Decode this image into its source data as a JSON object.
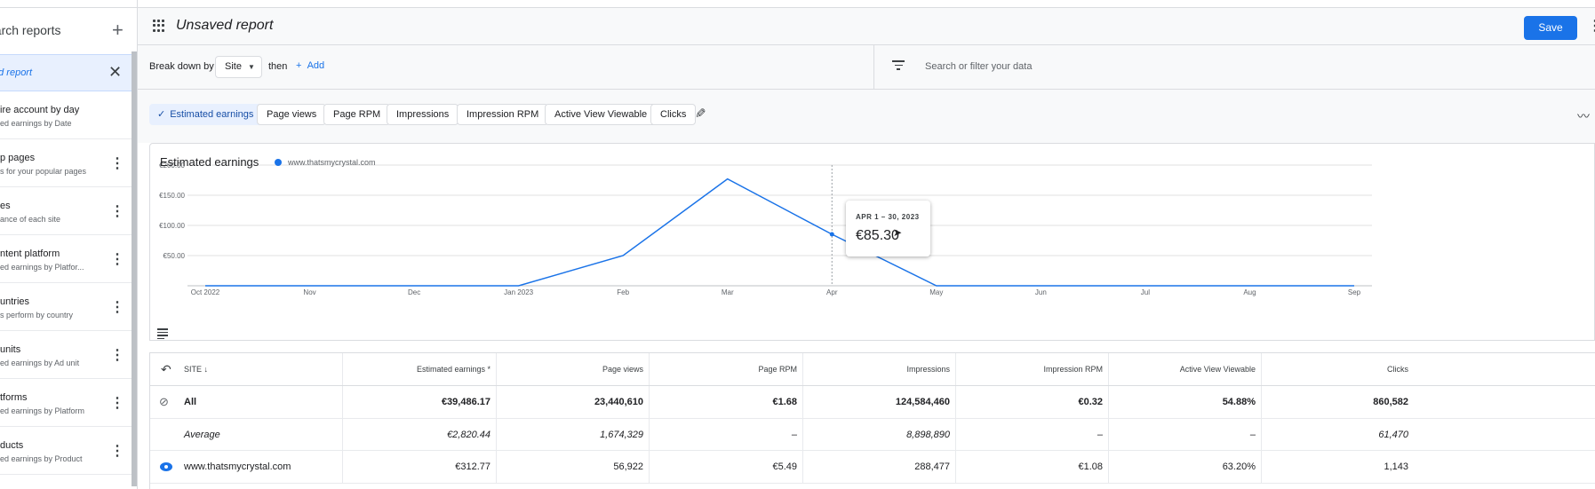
{
  "sidebar": {
    "search_label": "earch reports",
    "active_report": "ed report",
    "items": [
      {
        "title": "ire account by day",
        "subtitle": "ed earnings by Date"
      },
      {
        "title": "p pages",
        "subtitle": "s for your popular pages"
      },
      {
        "title": "es",
        "subtitle": "ance of each site"
      },
      {
        "title": "ntent platform",
        "subtitle": "ed earnings by Platfor..."
      },
      {
        "title": "untries",
        "subtitle": "s perform by country"
      },
      {
        "title": "units",
        "subtitle": "ed earnings by Ad unit"
      },
      {
        "title": "tforms",
        "subtitle": "ed earnings by Platform"
      },
      {
        "title": "ducts",
        "subtitle": "ed earnings by Product"
      }
    ]
  },
  "header": {
    "title": "Unsaved report",
    "save_label": "Save"
  },
  "breakdown": {
    "label": "Break down by",
    "dimension": "Site",
    "then_label": "then",
    "add_label": "Add",
    "search_placeholder": "Search or filter your data"
  },
  "metrics": [
    {
      "label": "Estimated earnings",
      "selected": true
    },
    {
      "label": "Page views",
      "selected": false
    },
    {
      "label": "Page RPM",
      "selected": false
    },
    {
      "label": "Impressions",
      "selected": false
    },
    {
      "label": "Impression RPM",
      "selected": false
    },
    {
      "label": "Active View Viewable",
      "selected": false
    },
    {
      "label": "Clicks",
      "selected": false
    }
  ],
  "chart_data": {
    "type": "line",
    "title": "Estimated earnings",
    "series": [
      {
        "name": "www.thatsmycrystal.com",
        "color": "#1a73e8",
        "values": [
          0,
          0,
          0,
          0,
          50,
          177,
          85.3,
          0,
          0,
          0,
          0,
          0
        ]
      }
    ],
    "x": [
      "Oct 2022",
      "Nov",
      "Dec",
      "Jan 2023",
      "Feb",
      "Mar",
      "Apr",
      "May",
      "Jun",
      "Jul",
      "Aug",
      "Sep"
    ],
    "y_ticks": [
      "€50.00",
      "€100.00",
      "€150.00",
      "€200.00"
    ],
    "ylim": [
      0,
      200
    ],
    "grid": true,
    "tooltip": {
      "date": "APR 1 – 30, 2023",
      "value": "€85.30"
    }
  },
  "table": {
    "columns": [
      "SITE",
      "Estimated earnings *",
      "Page views",
      "Page RPM",
      "Impressions",
      "Impression RPM",
      "Active View Viewable",
      "Clicks"
    ],
    "rows": [
      {
        "label": "All",
        "values": [
          "€39,486.17",
          "23,440,610",
          "€1.68",
          "124,584,460",
          "€0.32",
          "54.88%",
          "860,582"
        ]
      },
      {
        "label": "Average",
        "values": [
          "€2,820.44",
          "1,674,329",
          "–",
          "8,898,890",
          "–",
          "–",
          "61,470"
        ]
      },
      {
        "label": "www.thatsmycrystal.com",
        "values": [
          "€312.77",
          "56,922",
          "€5.49",
          "288,477",
          "€1.08",
          "63.20%",
          "1,143"
        ]
      }
    ]
  }
}
